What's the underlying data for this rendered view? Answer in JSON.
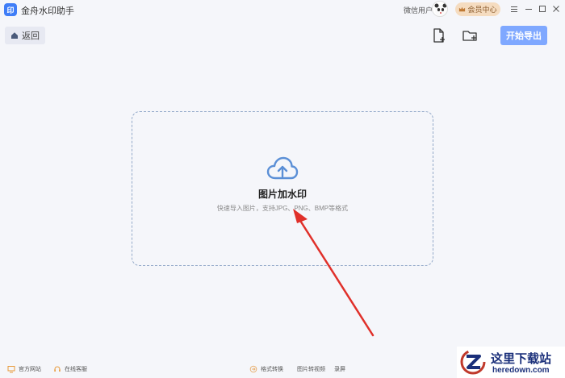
{
  "app": {
    "logo_text": "印",
    "title": "金舟水印助手",
    "user_name": "微信用户",
    "vip_label": "会员中心",
    "window_controls": [
      "menu-icon",
      "minimize-icon",
      "maximize-icon",
      "close-icon"
    ]
  },
  "toolbar": {
    "back_label": "返回",
    "add_file_icon": "add-file-icon",
    "add_folder_icon": "add-folder-icon",
    "export_label": "开始导出"
  },
  "dropzone": {
    "icon": "cloud-upload-icon",
    "title": "图片加水印",
    "subtitle": "快速导入图片，支持JPG、PNG、BMP等格式"
  },
  "footer": {
    "website_label": "官方网站",
    "service_label": "在线客服",
    "format_convert_label": "格式转换",
    "image_to_video_label": "图片转视频",
    "record_label": "录屏"
  },
  "watermark": {
    "cn_text": "这里下载站",
    "en_text": "heredown.com"
  },
  "colors": {
    "accent": "#7fa8ff",
    "logo": "#3f7df7",
    "vip_bg": "#f5dcc0",
    "arrow": "#e0302a",
    "background": "#f5f6fa"
  }
}
